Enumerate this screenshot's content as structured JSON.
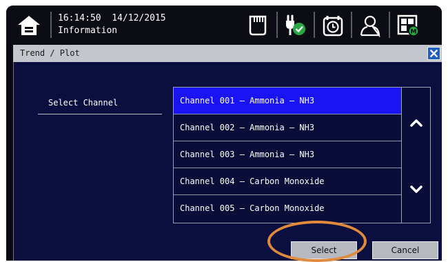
{
  "status": {
    "time": "16:14:50",
    "date": "14/12/2015",
    "screen_name": "Information"
  },
  "icons": {
    "home": "home-icon",
    "memory": "memory-card-icon",
    "power": "power-plug-ok-icon",
    "alarm": "alarm-clock-icon",
    "user": "user-icon",
    "menu": "grid-menu-icon"
  },
  "dialog": {
    "title": "Trend / Plot",
    "select_label": "Select Channel",
    "channels": [
      "Channel 001 – Ammonia – NH3",
      "Channel 002 – Ammonia – NH3",
      "Channel 003 – Ammonia – NH3",
      "Channel 004 – Carbon Monoxide",
      "Channel 005 – Carbon Monoxide"
    ],
    "selected_index": 0,
    "select_button": "Select",
    "cancel_button": "Cancel"
  },
  "colors": {
    "selected_row": "#1a14f4",
    "dialog_bg": "#0b0f3f",
    "highlight": "#e28a3c",
    "status_ok": "#27a844"
  }
}
